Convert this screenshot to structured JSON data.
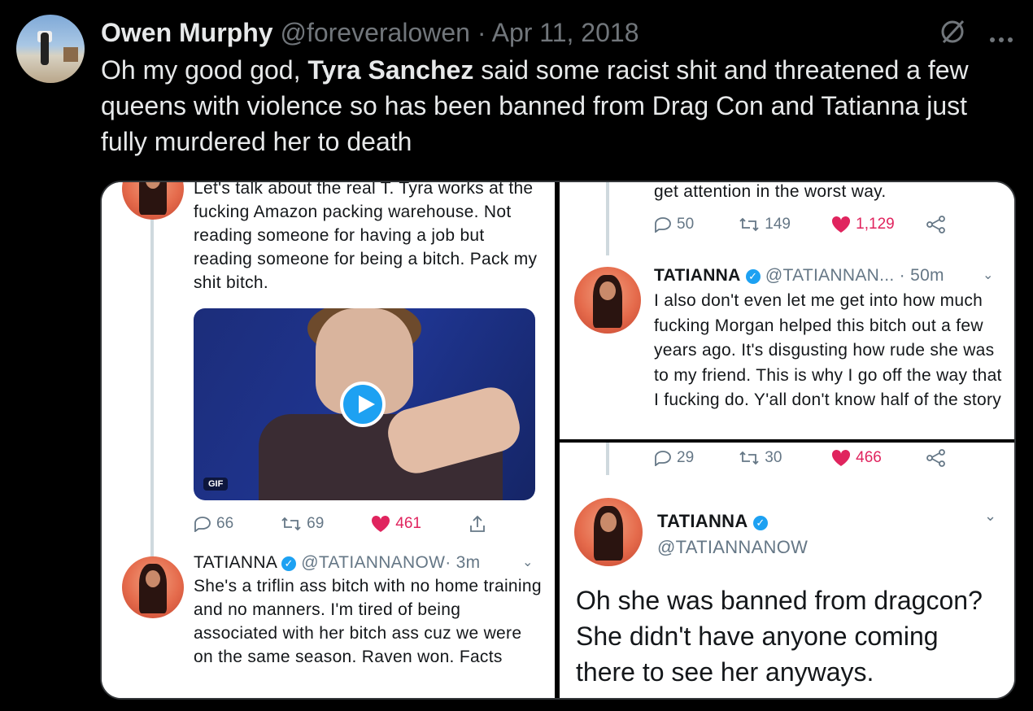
{
  "tweet": {
    "author_name": "Owen Murphy",
    "author_handle": "@foreveralowen",
    "separator": "·",
    "date": "Apr 11, 2018",
    "text_before": "Oh my good god, ",
    "mention": "Tyra Sanchez",
    "text_after": " said some racist shit and threatened a few queens with violence so has been banned from Drag Con and Tatianna just fully murdered her to death",
    "icons": {
      "grok": "slashed-circle-icon",
      "more": "more-icon"
    }
  },
  "panel1": {
    "tweet1_text": "Let's talk about the real T. Tyra works at the fucking Amazon packing warehouse. Not reading someone for having a job but reading someone for being a bitch. Pack my shit bitch.",
    "gif_label": "GIF",
    "actions": {
      "replies": "66",
      "retweets": "69",
      "likes": "461"
    },
    "tweet2": {
      "name": "TATIANNA",
      "handle": "@TATIANNANOW",
      "time": "· 3m",
      "text": "She's a triflin ass bitch with no home training and no manners. I'm tired of being associated with her bitch ass cuz we were on the same season. Raven won. Facts"
    }
  },
  "panel2": {
    "top_text": "get attention in the worst way.",
    "actions_top": {
      "replies": "50",
      "retweets": "149",
      "likes": "1,129"
    },
    "tweet": {
      "name": "TATIANNA",
      "handle": "@TATIANNAN...",
      "time": "· 50m",
      "text": "I also don't even let me get into how much fucking Morgan helped this bitch out a few years ago. It's disgusting how rude she was to my friend. This is why I go off the way that I fucking do. Y'all don't know half of the story"
    }
  },
  "panel3": {
    "actions": {
      "replies": "29",
      "retweets": "30",
      "likes": "466"
    },
    "name": "TATIANNA",
    "handle": "@TATIANNANOW",
    "text": "Oh she was banned from dragcon? She didn't have anyone coming there to see her anyways."
  },
  "colors": {
    "background": "#000000",
    "likes": "#e0245e",
    "verified": "#1da1f2"
  }
}
